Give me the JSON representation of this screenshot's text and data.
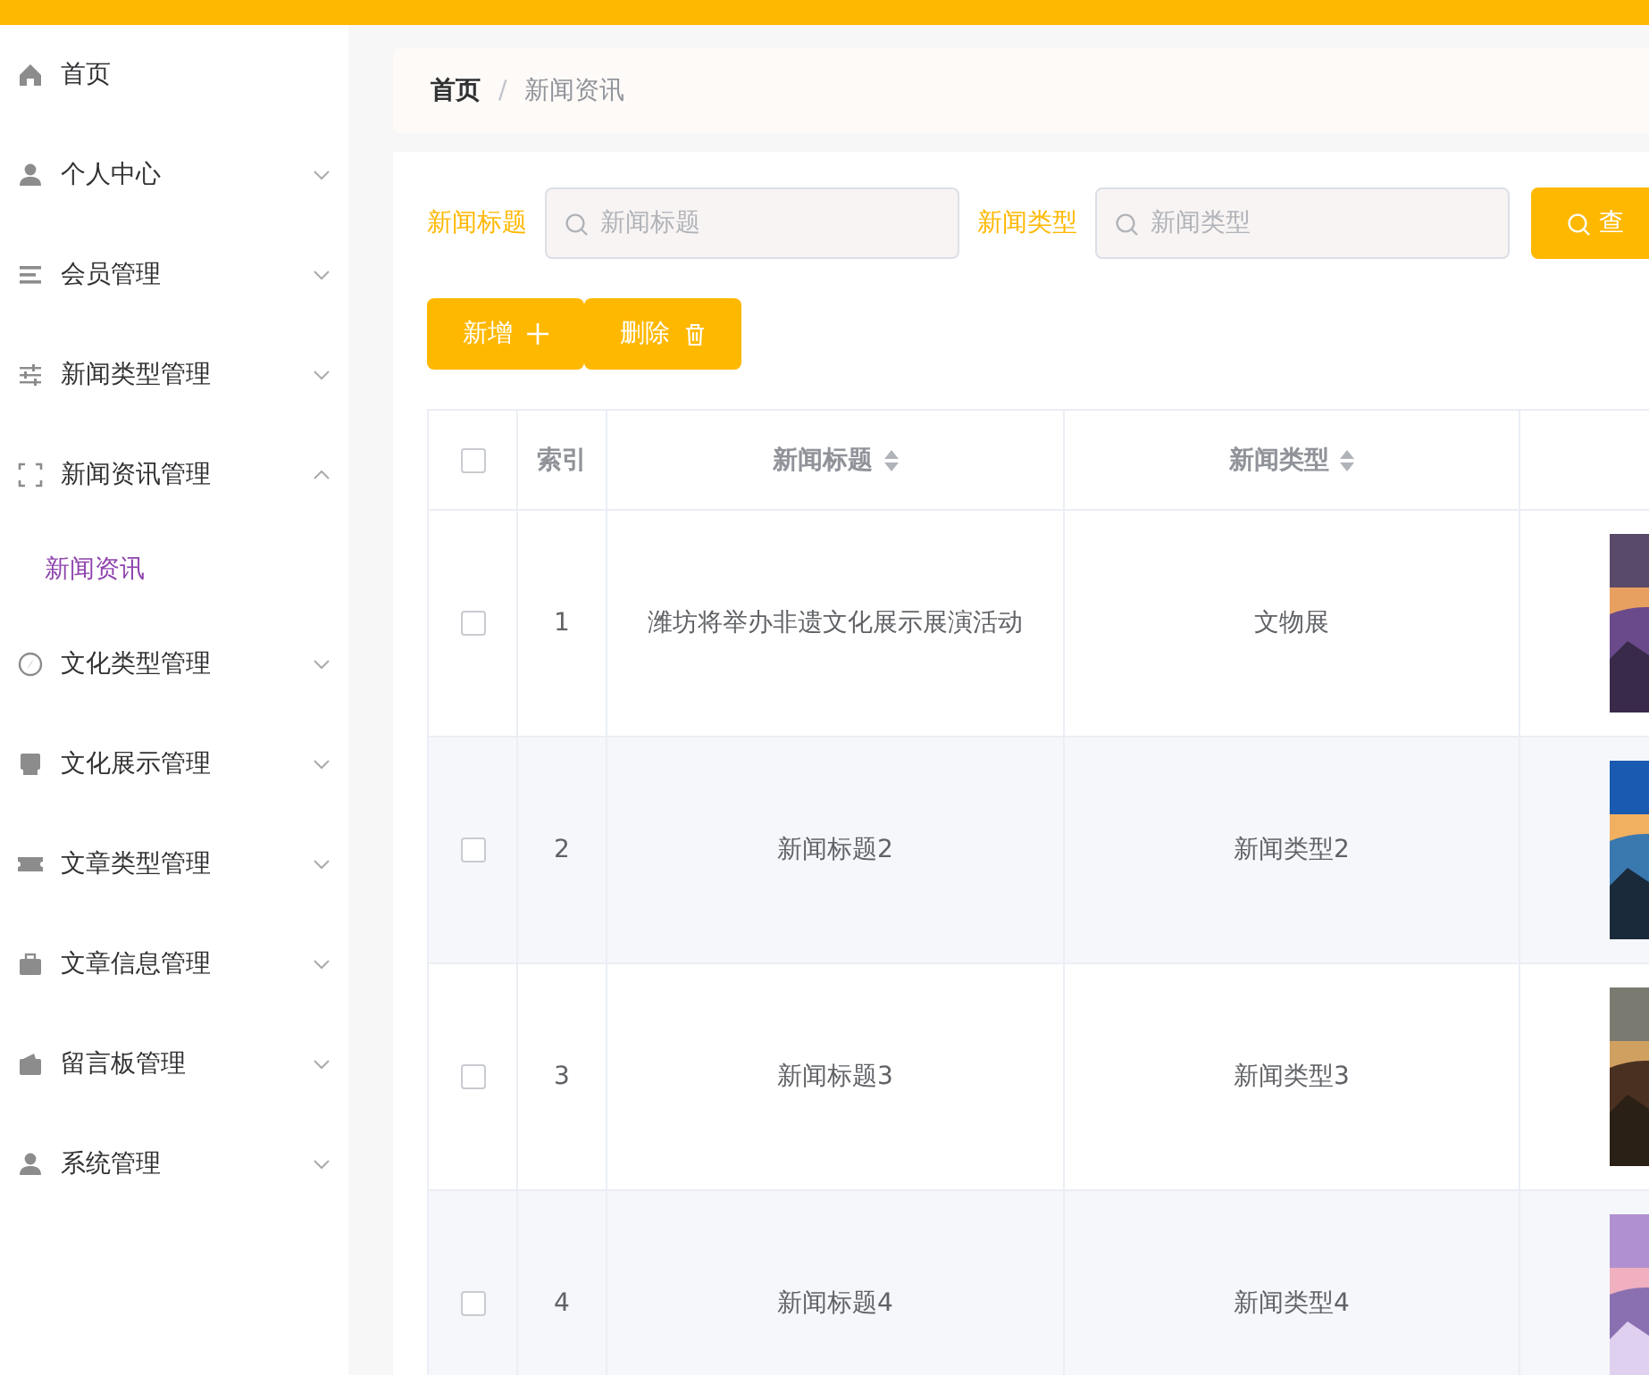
{
  "sidebar": {
    "items": [
      {
        "label": "首页",
        "kind": "link"
      },
      {
        "label": "个人中心",
        "kind": "submenu",
        "expanded": false
      },
      {
        "label": "会员管理",
        "kind": "submenu",
        "expanded": false
      },
      {
        "label": "新闻类型管理",
        "kind": "submenu",
        "expanded": false
      },
      {
        "label": "新闻资讯管理",
        "kind": "submenu",
        "expanded": true,
        "children": [
          {
            "label": "新闻资讯",
            "selected": true
          }
        ]
      },
      {
        "label": "文化类型管理",
        "kind": "submenu",
        "expanded": false
      },
      {
        "label": "文化展示管理",
        "kind": "submenu",
        "expanded": false
      },
      {
        "label": "文章类型管理",
        "kind": "submenu",
        "expanded": false
      },
      {
        "label": "文章信息管理",
        "kind": "submenu",
        "expanded": false
      },
      {
        "label": "留言板管理",
        "kind": "submenu",
        "expanded": false
      },
      {
        "label": "系统管理",
        "kind": "submenu",
        "expanded": false
      }
    ]
  },
  "breadcrumb": [
    "首页",
    "新闻资讯"
  ],
  "breadcrumb_separator": "/",
  "search": {
    "fields": [
      {
        "label": "新闻标题",
        "placeholder": "新闻标题"
      },
      {
        "label": "新闻类型",
        "placeholder": "新闻类型"
      }
    ],
    "button": "查"
  },
  "actions": [
    {
      "label": "新增",
      "kind": "add"
    },
    {
      "label": "删除",
      "kind": "delete"
    }
  ],
  "table": {
    "all_checked": false,
    "columns": [
      {
        "label": "索引",
        "sortable": false
      },
      {
        "label": "新闻标题",
        "sortable": true
      },
      {
        "label": "新闻类型",
        "sortable": true
      }
    ],
    "rows": [
      {
        "checked": false,
        "index": "1",
        "title": "潍坊将举办非遗文化展示展演活动",
        "type": "文物展"
      },
      {
        "checked": false,
        "index": "2",
        "title": "新闻标题2",
        "type": "新闻类型2"
      },
      {
        "checked": false,
        "index": "3",
        "title": "新闻标题3",
        "type": "新闻类型3"
      },
      {
        "checked": false,
        "index": "4",
        "title": "新闻标题4",
        "type": "新闻类型4"
      }
    ]
  }
}
